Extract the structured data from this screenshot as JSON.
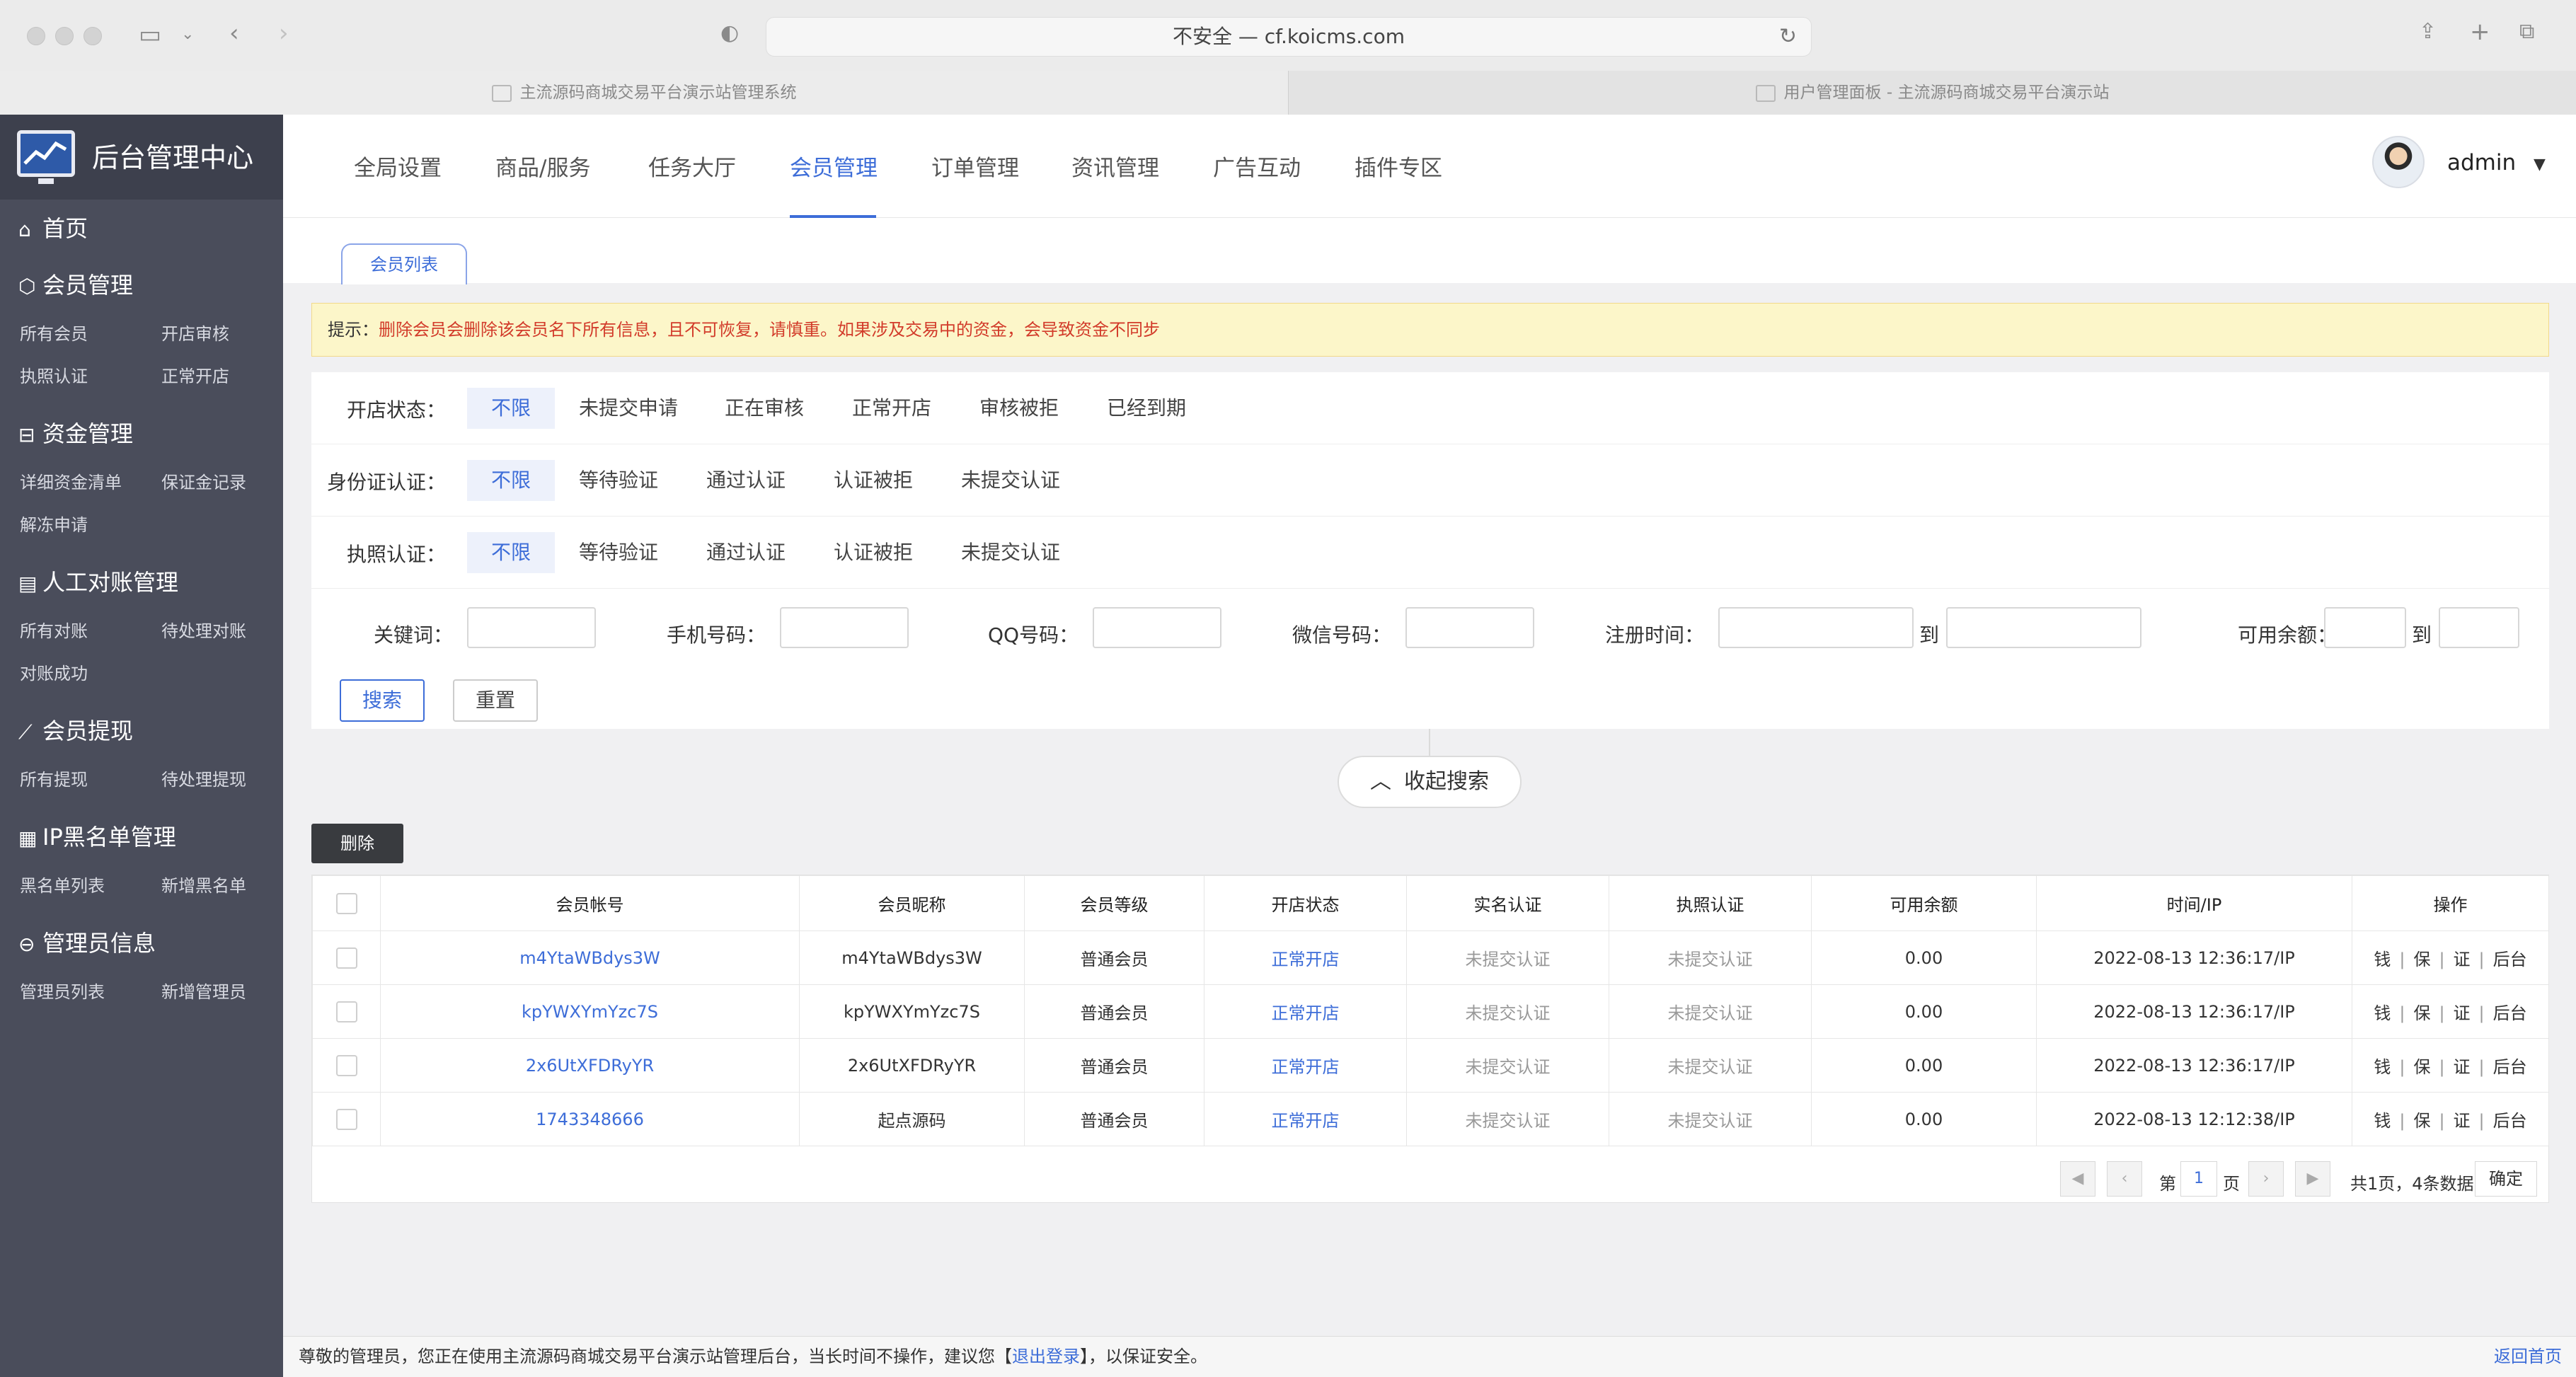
{
  "browser": {
    "address": "不安全 — cf.koicms.com",
    "tabs": [
      "主流源码商城交易平台演示站管理系统",
      "用户管理面板 - 主流源码商城交易平台演示站"
    ]
  },
  "sidebar": {
    "brand": "后台管理中心",
    "home": "首页",
    "groups": [
      {
        "title": "会员管理",
        "items": [
          "所有会员",
          "开店审核",
          "执照认证",
          "正常开店"
        ]
      },
      {
        "title": "资金管理",
        "items": [
          "详细资金清单",
          "保证金记录",
          "解冻申请"
        ]
      },
      {
        "title": "人工对账管理",
        "items": [
          "所有对账",
          "待处理对账",
          "对账成功"
        ]
      },
      {
        "title": "会员提现",
        "items": [
          "所有提现",
          "待处理提现"
        ]
      },
      {
        "title": "IP黑名单管理",
        "items": [
          "黑名单列表",
          "新增黑名单"
        ]
      },
      {
        "title": "管理员信息",
        "items": [
          "管理员列表",
          "新增管理员"
        ]
      }
    ]
  },
  "topnav": {
    "items": [
      "全局设置",
      "商品/服务",
      "任务大厅",
      "会员管理",
      "订单管理",
      "资讯管理",
      "广告互动",
      "插件专区"
    ],
    "active": "会员管理",
    "user": "admin"
  },
  "subtab": "会员列表",
  "notice": {
    "label": "提示：",
    "message": "删除会员会删除该会员名下所有信息，且不可恢复，请慎重。如果涉及交易中的资金，会导致资金不同步"
  },
  "filters": {
    "shop_status": {
      "label": "开店状态：",
      "options": [
        "不限",
        "未提交申请",
        "正在审核",
        "正常开店",
        "审核被拒",
        "已经到期"
      ]
    },
    "id_auth": {
      "label": "身份证认证：",
      "options": [
        "不限",
        "等待验证",
        "通过认证",
        "认证被拒",
        "未提交认证"
      ]
    },
    "license_auth": {
      "label": "执照认证：",
      "options": [
        "不限",
        "等待验证",
        "通过认证",
        "认证被拒",
        "未提交认证"
      ]
    },
    "search": {
      "keyword": "关键词：",
      "phone": "手机号码：",
      "qq": "QQ号码：",
      "wechat": "微信号码：",
      "reg_time": "注册时间：",
      "balance": "可用余额：",
      "to": "到"
    },
    "search_btn": "搜索",
    "reset_btn": "重置"
  },
  "collapse": "收起搜索",
  "delete_btn": "删除",
  "table": {
    "headers": [
      "会员帐号",
      "会员昵称",
      "会员等级",
      "开店状态",
      "实名认证",
      "执照认证",
      "可用余额",
      "时间/IP",
      "操作"
    ],
    "rows": [
      [
        "m4YtaWBdys3W",
        "m4YtaWBdys3W",
        "普通会员",
        "正常开店",
        "未提交认证",
        "未提交认证",
        "0.00",
        "2022-08-13 12:36:17/IP"
      ],
      [
        "kpYWXYmYzc7S",
        "kpYWXYmYzc7S",
        "普通会员",
        "正常开店",
        "未提交认证",
        "未提交认证",
        "0.00",
        "2022-08-13 12:36:17/IP"
      ],
      [
        "2x6UtXFDRyYR",
        "2x6UtXFDRyYR",
        "普通会员",
        "正常开店",
        "未提交认证",
        "未提交认证",
        "0.00",
        "2022-08-13 12:36:17/IP"
      ],
      [
        "1743348666",
        "起点源码",
        "普通会员",
        "正常开店",
        "未提交认证",
        "未提交认证",
        "0.00",
        "2022-08-13 12:12:38/IP"
      ]
    ],
    "ops": [
      "钱",
      "保",
      "证",
      "后台"
    ]
  },
  "pager": {
    "prefix": "第",
    "page": "1",
    "suffix": "页",
    "summary": "共1页，4条数据",
    "confirm": "确定"
  },
  "footer": {
    "before": "尊敬的管理员，您正在使用主流源码商城交易平台演示站管理后台，当长时间不操作，建议您【",
    "logout": "退出登录",
    "after": "】，以保证安全。",
    "back": "返回首页"
  }
}
